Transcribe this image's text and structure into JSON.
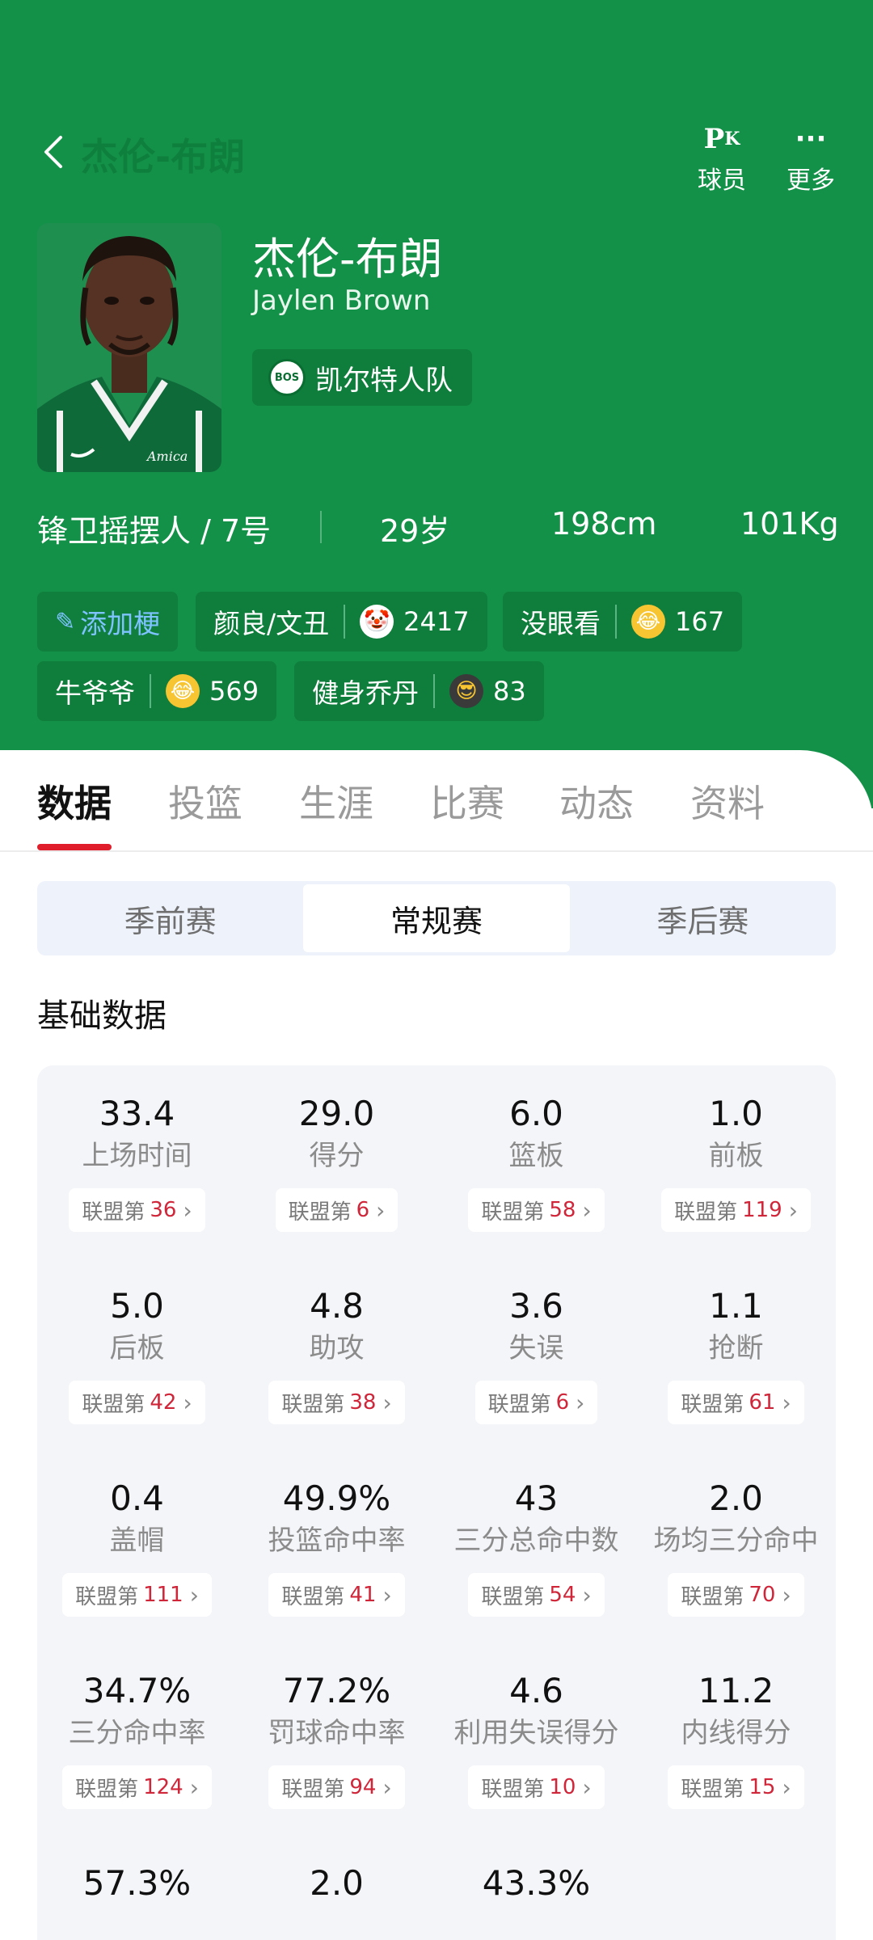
{
  "nav": {
    "title": "杰伦-布朗",
    "pk_label": "球员",
    "more_label": "更多"
  },
  "player": {
    "name_cn": "杰伦-布朗",
    "name_en": "Jaylen Brown",
    "team": "凯尔特人队",
    "team_abbr": "BOS",
    "position_number": "锋卫摇摆人 / 7号",
    "age": "29岁",
    "height": "198cm",
    "weight": "101Kg",
    "jersey_text": "Amica"
  },
  "tags": [
    {
      "label": "添加梗"
    },
    {
      "label": "颜良/文丑",
      "count": "2417",
      "emoji": "clown-face"
    },
    {
      "label": "没眼看",
      "count": "167",
      "emoji": "laughing-face"
    },
    {
      "label": "牛爷爷",
      "count": "569",
      "emoji": "laughing-face"
    },
    {
      "label": "健身乔丹",
      "count": "83",
      "emoji": "sunglasses-face"
    }
  ],
  "tabs": [
    "数据",
    "投篮",
    "生涯",
    "比赛",
    "动态",
    "资料"
  ],
  "active_tab": "数据",
  "season_types": [
    "季前赛",
    "常规赛",
    "季后赛"
  ],
  "active_season": "常规赛",
  "section_title": "基础数据",
  "rank_prefix": "联盟第",
  "stats": [
    {
      "value": "33.4",
      "label": "上场时间",
      "rank": "36"
    },
    {
      "value": "29.0",
      "label": "得分",
      "rank": "6"
    },
    {
      "value": "6.0",
      "label": "篮板",
      "rank": "58"
    },
    {
      "value": "1.0",
      "label": "前板",
      "rank": "119"
    },
    {
      "value": "5.0",
      "label": "后板",
      "rank": "42"
    },
    {
      "value": "4.8",
      "label": "助攻",
      "rank": "38"
    },
    {
      "value": "3.6",
      "label": "失误",
      "rank": "6"
    },
    {
      "value": "1.1",
      "label": "抢断",
      "rank": "61"
    },
    {
      "value": "0.4",
      "label": "盖帽",
      "rank": "111"
    },
    {
      "value": "49.9%",
      "label": "投篮命中率",
      "rank": "41"
    },
    {
      "value": "43",
      "label": "三分总命中数",
      "rank": "54"
    },
    {
      "value": "2.0",
      "label": "场均三分命中",
      "rank": "70"
    },
    {
      "value": "34.7%",
      "label": "三分命中率",
      "rank": "124"
    },
    {
      "value": "77.2%",
      "label": "罚球命中率",
      "rank": "94"
    },
    {
      "value": "4.6",
      "label": "利用失误得分",
      "rank": "10"
    },
    {
      "value": "11.2",
      "label": "内线得分",
      "rank": "15"
    },
    {
      "value": "57.3%",
      "label": "",
      "rank": ""
    },
    {
      "value": "2.0",
      "label": "",
      "rank": ""
    },
    {
      "value": "43.3%",
      "label": "",
      "rank": ""
    }
  ],
  "colors": {
    "header_green": "#149149",
    "accent_red": "#e01e2b",
    "rank_red": "#d0263a"
  }
}
